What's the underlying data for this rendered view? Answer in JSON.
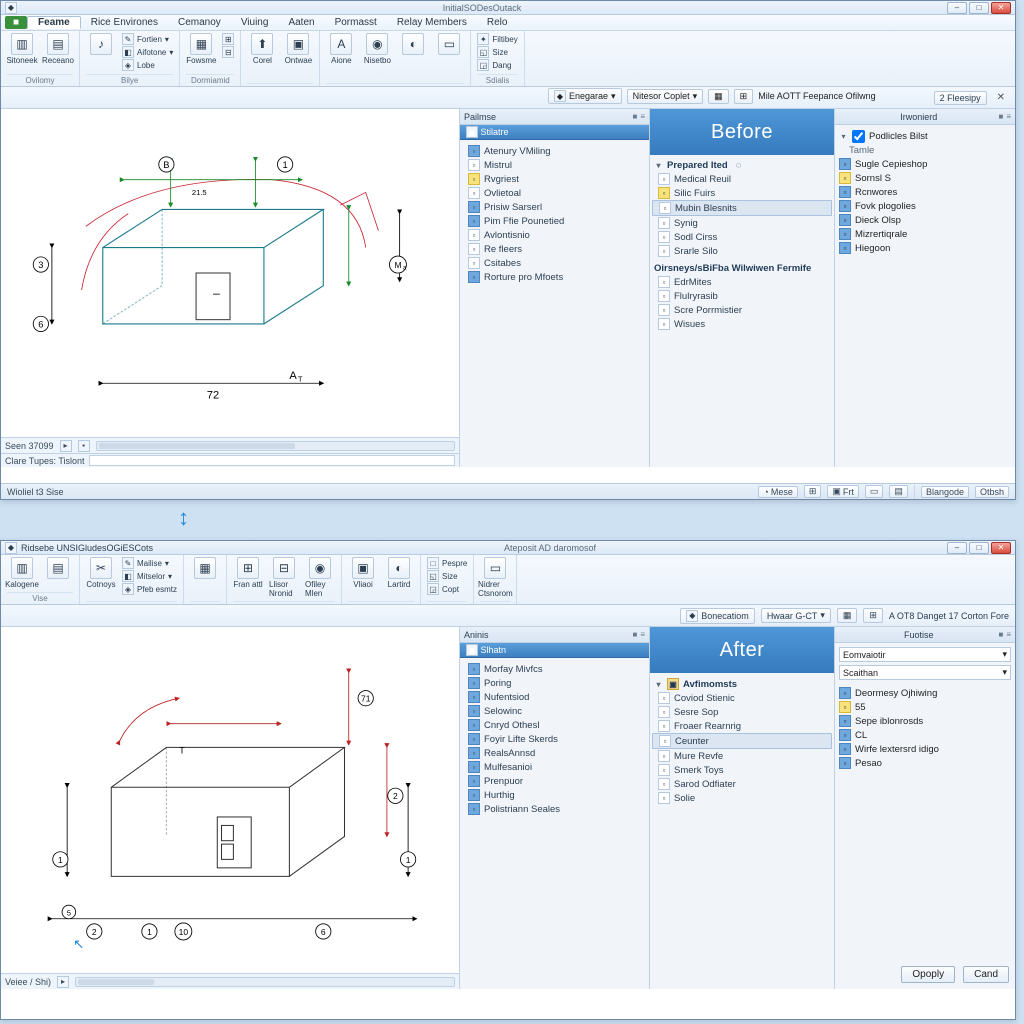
{
  "top": {
    "title_left": "",
    "title_center": "InitialSODesOutack",
    "menubar": [
      "Feame",
      "Rice Environes",
      "Cemanoy",
      "Viuing",
      "Aaten",
      "Pormasst",
      "Relay Members",
      "Relo"
    ],
    "qb": {
      "tabname": "2 Fleesipy",
      "b1": "Enegarae",
      "b2": "Nitesor Coplet",
      "b3": "Mile AOTT Feepance Ofilwng"
    },
    "ribbon": {
      "g1_big": [
        "Sitoneek",
        "Receano"
      ],
      "g1_label": "Ovilomy",
      "g2_small": [
        "Fortien",
        "Aifotone",
        "Lobe"
      ],
      "g2_label": "Bilye",
      "g3_big": [
        "Fowsme"
      ],
      "g3_small": [
        "",
        ""
      ],
      "g3_label": "Dormiamid",
      "g4_big": [
        "Corel",
        "Ontwae"
      ],
      "g4_label": "",
      "g5_big": [
        "Aione",
        "Nisetbo"
      ],
      "g5_small": [
        "Filtibey",
        "Size",
        "Dang"
      ],
      "g5_label": "Sdialis"
    },
    "tree1_header": "Pailmse",
    "tree1_tab": "Stilatre",
    "tree1": [
      "Atenury VMiling",
      "Mistrul",
      "Rvgriest",
      "Ovlietoal",
      "Prisiw Sarserl",
      "Pim Ffie Pounetied",
      "Avlontisnio",
      "Re fleers",
      "Csitabes",
      "Rorture pro Mfoets"
    ],
    "tree2_head": "Prepared Ited",
    "tree2": [
      "Medical Reuil",
      "Silic Fuirs",
      "Mubin Blesnits",
      "Synig",
      "Sodl Cirss",
      "Srarle Silo"
    ],
    "tree2_sel": 2,
    "tree2_head2": "Oirsneys/sBiFba Wilwiwen Fermife",
    "tree2b": [
      "EdrMites",
      "Flulryrasib",
      "Scre Porrmistier",
      "Wisues"
    ],
    "big_label": "Before",
    "prop_header": "Irwonierd",
    "prop_chk": "Podlicles Bilst",
    "prop_sub": "Tamle",
    "prop_items": [
      "Sugle Cepieshop",
      "Sornsl S",
      "Rcnwores",
      "Fovk plogolies",
      "Dieck Olsp",
      "Mizrertiqrale",
      "Hiegoon"
    ],
    "canvas_tabs": "Seen 37099",
    "cmdbar_label": "Clare Tupes: Tislont",
    "status_left": "Wioliel t3 Sise",
    "status_right": [
      "Mese",
      "",
      "Frt",
      "",
      "",
      "Blangode",
      "Otbsh"
    ],
    "dims": {
      "w": "72",
      "h": "A",
      "top": "B",
      "left_a": "3",
      "left_b": "6",
      "right": "1",
      "r2": "M",
      "t": "21.5"
    }
  },
  "bottom": {
    "title_left": "Ridsebe UNSIGludesOGiESCots",
    "title_center": "Ateposit AD daromosof",
    "menubar": [
      "Kalogene",
      "Vise",
      "Cotnoys"
    ],
    "menubar_small": [
      "Mailise",
      "Mitselor",
      "Pfeb esmtz"
    ],
    "ribbon": {
      "g1_big": [
        "Kalogene",
        ""
      ],
      "g2_big": [
        "Cotnoys"
      ],
      "g3_big": [
        "",
        "Fran attl",
        "Llisor Nronid",
        "Ofiley Mlen"
      ],
      "g4_big": [
        "",
        "Vliaoi",
        "Lartird"
      ],
      "g5_small": [
        "Pespre",
        "Size",
        "Copt"
      ],
      "g6_big": [
        "",
        "Nidrer Ctsnorom"
      ]
    },
    "qb": {
      "b1": "Bonecatiom",
      "b2": "Hwaar G-CT",
      "b3": "A OT8 Danget 17 Corton Fore"
    },
    "tree1_header": "Aninis",
    "tree1_tab": "Slhatn",
    "tree1": [
      "Morfay Mivfcs",
      "Poring",
      "Nufentsiod",
      "Selowinc",
      "Cnryd Othesl",
      "Foyir Lifte Skerds",
      "RealsAnnsd",
      "Mulfesanioi",
      "Prenpuor",
      "Hurthig",
      "Polistriann Seales"
    ],
    "tree2_head": "Avfimomsts",
    "tree2": [
      "Coviod Stienic",
      "Sesre Sop",
      "Froaer Rearnrig",
      "Ceunter",
      "Mure Revfe",
      "Smerk Toys",
      "Sarod Odfiater",
      "Solie"
    ],
    "tree2_sel": 3,
    "big_label": "After",
    "prop_header": "Fuotise",
    "prop_sel1": "Eomvaiotir",
    "prop_sel2": "Scaithan",
    "prop_items": [
      "Deormesy Ojhiwing",
      "55",
      "Sepe iblonrosds",
      "CL",
      "Wirfe lextersrd idigo",
      "Pesao"
    ],
    "btn_apply": "Opoply",
    "btn_cancel": "Cand",
    "canvas_tabs": "Veiee / Shi)",
    "dims": {
      "a": "71",
      "b": "2",
      "c": "1",
      "d": "1",
      "e": "2",
      "f": "10",
      "g": "6",
      "h": "T",
      "i": "1",
      "j": "5"
    }
  }
}
